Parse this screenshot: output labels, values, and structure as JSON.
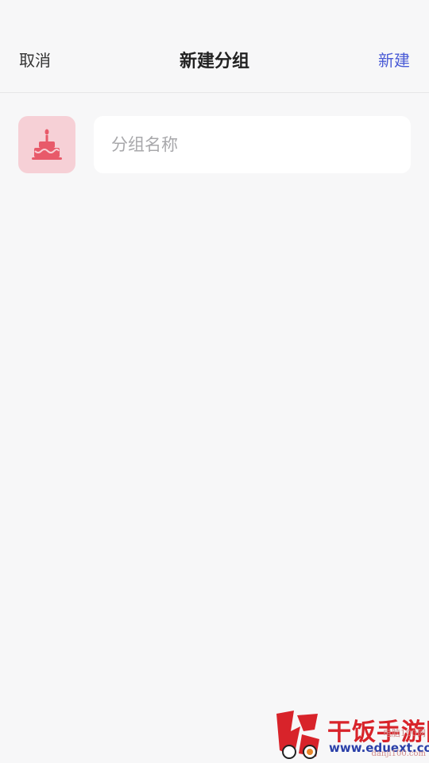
{
  "header": {
    "cancel_label": "取消",
    "title": "新建分组",
    "create_label": "新建"
  },
  "group": {
    "icon": "cake-icon",
    "name_value": "",
    "name_placeholder": "分组名称"
  },
  "watermark": {
    "title": "干饭手游网",
    "url": "www.eduext.com",
    "sub1": "电脑100网",
    "sub2": "danji100.com"
  },
  "colors": {
    "accent": "#4a5bd6",
    "icon_bg": "#f6d0d6",
    "icon_fg": "#e85a6a",
    "background": "#f7f7f8"
  }
}
